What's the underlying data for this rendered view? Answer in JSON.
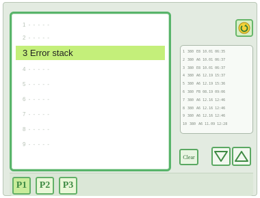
{
  "list": {
    "rows": [
      {
        "label": "1 - - - - -",
        "selected": false
      },
      {
        "label": "2 - - - - -",
        "selected": false
      },
      {
        "label": "3 Error stack",
        "selected": true
      },
      {
        "label": "4 - - - - -",
        "selected": false
      },
      {
        "label": "5 - - - - -",
        "selected": false
      },
      {
        "label": "6 - - - - -",
        "selected": false
      },
      {
        "label": "7 - - - - -",
        "selected": false
      },
      {
        "label": "8 - - - - -",
        "selected": false
      },
      {
        "label": "9 - - - - -",
        "selected": false
      }
    ]
  },
  "stack": {
    "lines": [
      {
        "n": "1",
        "code": "380",
        "info": "E8 10.01 06:35"
      },
      {
        "n": "2",
        "code": "380",
        "info": "A6 10.01 06:37"
      },
      {
        "n": "3",
        "code": "380",
        "info": "E8 10.01 06:37"
      },
      {
        "n": "4",
        "code": "380",
        "info": "A6 12.19 15:37"
      },
      {
        "n": "5",
        "code": "380",
        "info": "A6 12.19 15:36"
      },
      {
        "n": "6",
        "code": "380",
        "info": "FB 08.19 09:06"
      },
      {
        "n": "7",
        "code": "380",
        "info": "A6 12.16 12:46"
      },
      {
        "n": "8",
        "code": "380",
        "info": "A6 12.16 12:46"
      },
      {
        "n": "9",
        "code": "380",
        "info": "A6 12.16 12:46"
      },
      {
        "n": "10",
        "code": "380",
        "info": "A6 11.09 12:28"
      }
    ]
  },
  "buttons": {
    "clear_label": "Clear"
  },
  "tabs": [
    {
      "label": "P1",
      "active": true
    },
    {
      "label": "P2",
      "active": false
    },
    {
      "label": "P3",
      "active": false
    }
  ],
  "icons": {
    "top_right": "refresh-icon",
    "arrow_down": "arrow-down-icon",
    "arrow_up": "arrow-up-icon"
  },
  "colors": {
    "accent": "#58b46a",
    "selected_row": "#c4ef7a",
    "background": "#e3ebe1"
  }
}
